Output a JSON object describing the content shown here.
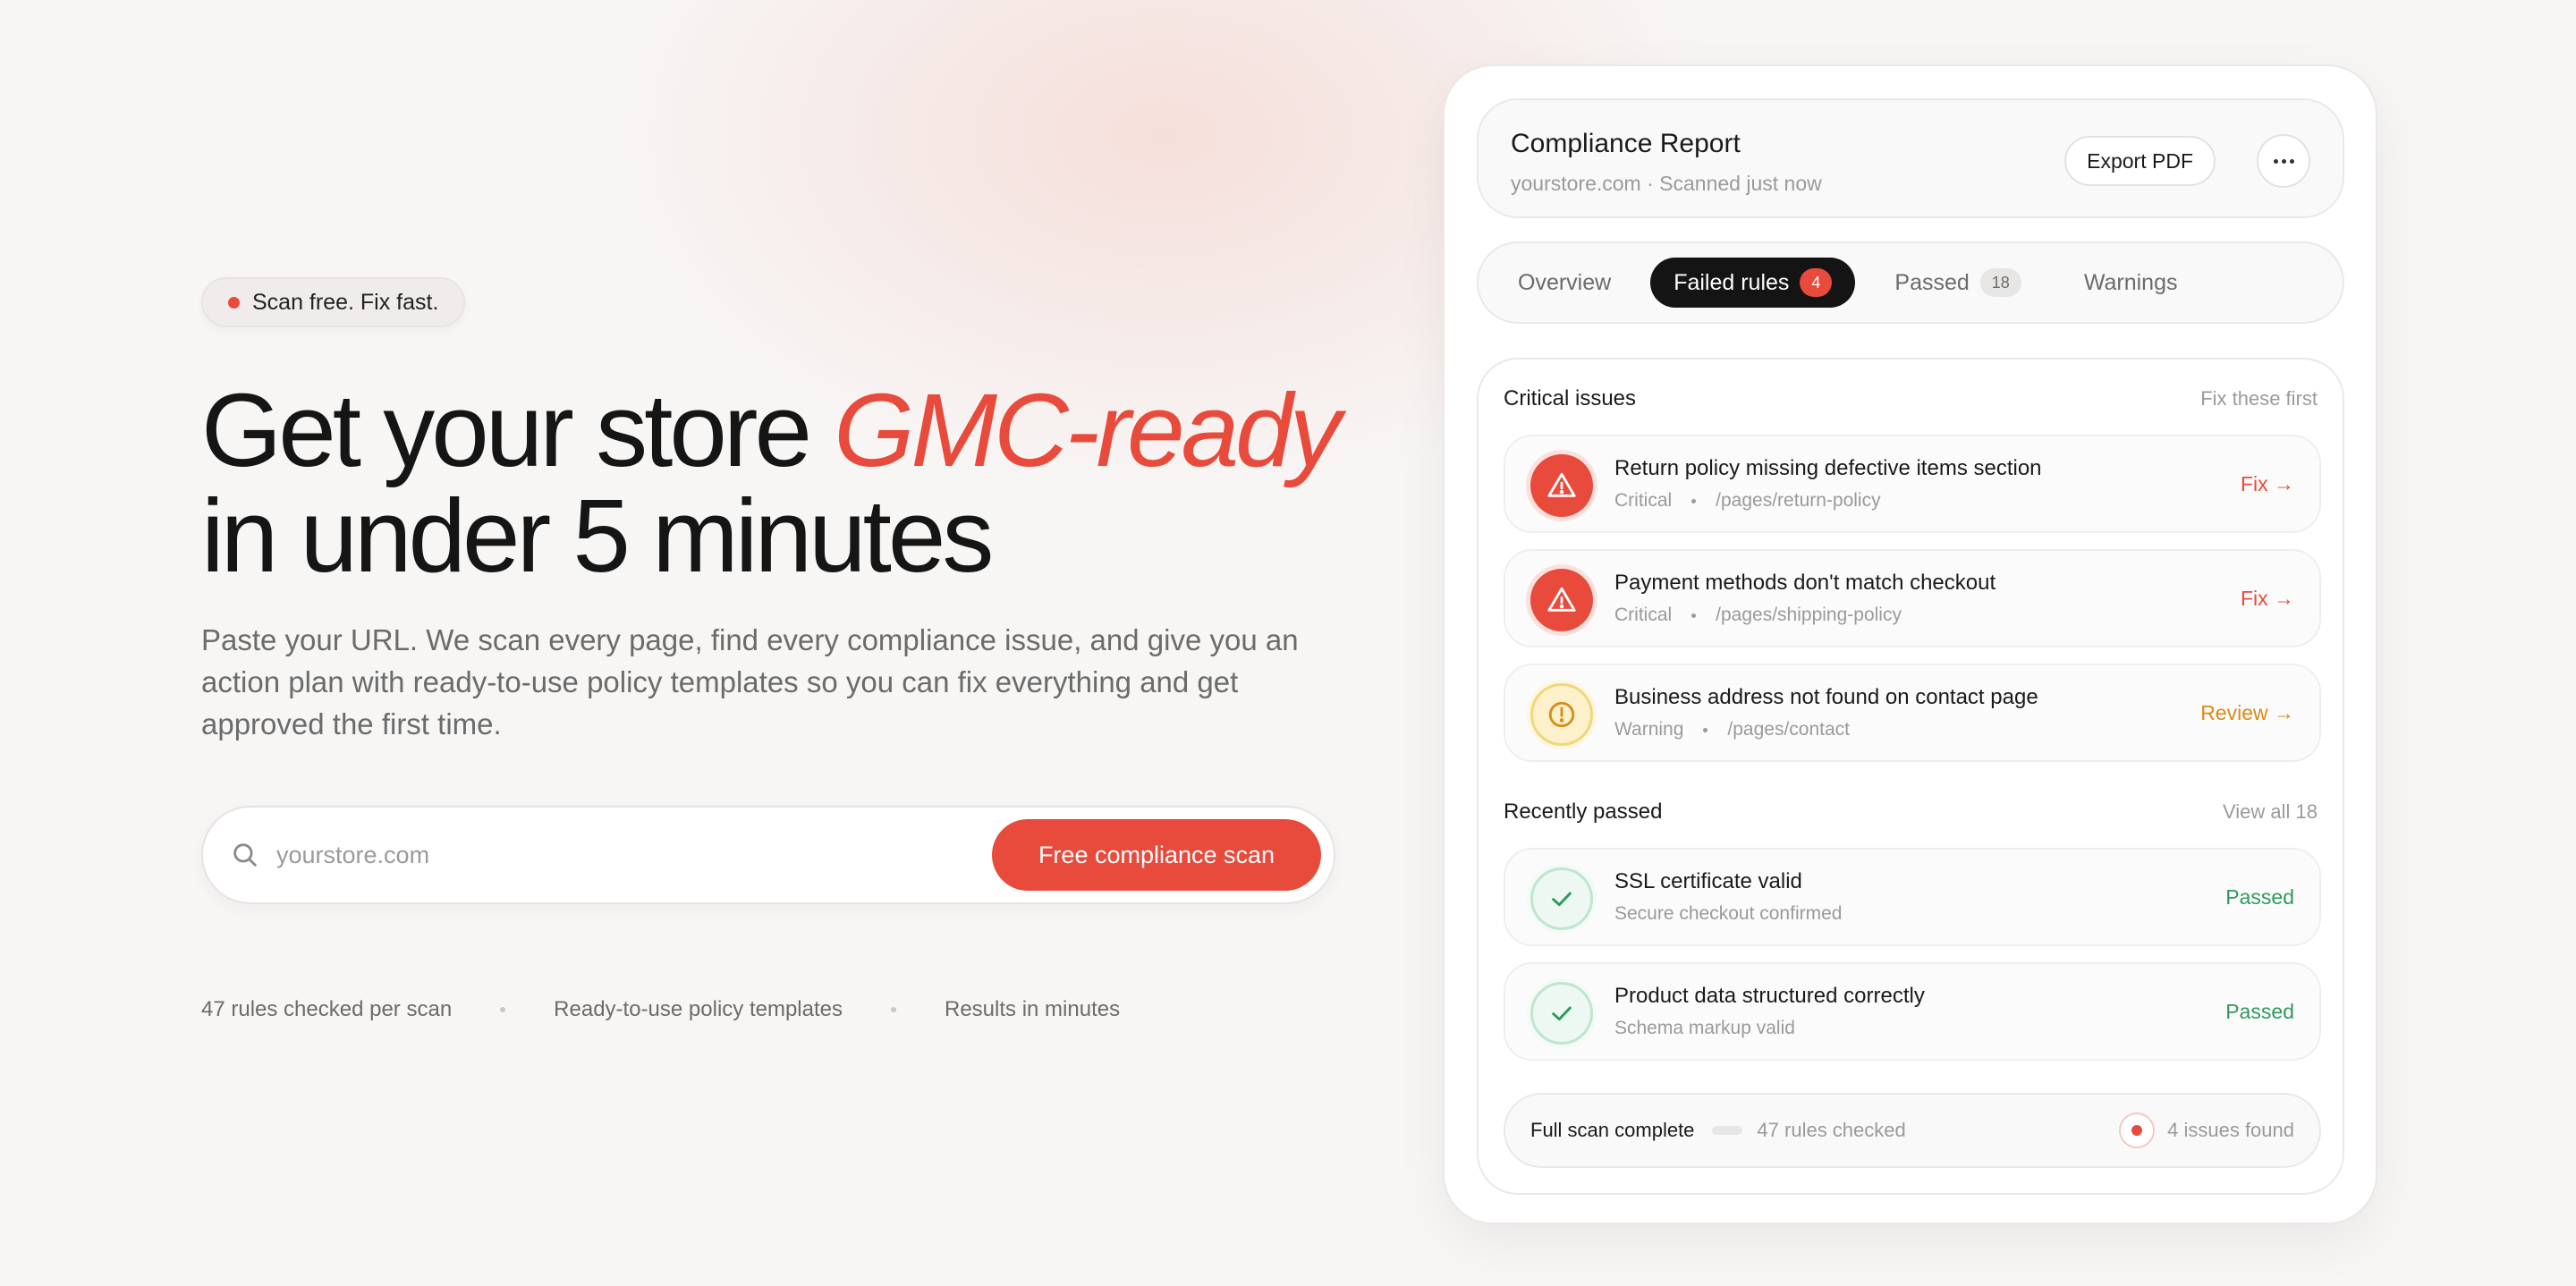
{
  "hero": {
    "tag": "Scan free. Fix fast.",
    "headline_pre": "Get your store ",
    "headline_accent": "GMC-ready",
    "headline_post": "in under 5 minutes",
    "subtext": "Paste your URL. We scan every page, find every compliance issue, and give you an action plan with ready-to-use policy templates so you can fix everything and get approved the first time.",
    "search_placeholder": "yourstore.com",
    "cta_label": "Free compliance scan",
    "stats": [
      "47 rules checked per scan",
      "Ready-to-use policy templates",
      "Results in minutes"
    ]
  },
  "report": {
    "title": "Compliance Report",
    "meta": "yourstore.com · Scanned just now",
    "export_label": "Export PDF",
    "tabs": [
      {
        "label": "Overview"
      },
      {
        "label": "Failed rules",
        "count": "4"
      },
      {
        "label": "Passed",
        "count": "18"
      },
      {
        "label": "Warnings"
      }
    ],
    "critical": {
      "label": "Critical issues",
      "action": "Fix these first",
      "items": [
        {
          "title": "Return policy missing defective items section",
          "severity": "Critical",
          "path": "/pages/return-policy",
          "action": "Fix →"
        },
        {
          "title": "Payment methods don't match checkout",
          "severity": "Critical",
          "path": "/pages/shipping-policy",
          "action": "Fix →"
        },
        {
          "title": "Business address not found on contact page",
          "severity": "Warning",
          "path": "/pages/contact",
          "action": "Review →"
        }
      ]
    },
    "passed": {
      "label": "Recently passed",
      "action": "View all 18",
      "items": [
        {
          "title": "SSL certificate valid",
          "detail": "Secure checkout confirmed",
          "status": "Passed"
        },
        {
          "title": "Product data structured correctly",
          "detail": "Schema markup valid",
          "status": "Passed"
        }
      ]
    },
    "footer": {
      "done": "Full scan complete",
      "rules": "47 rules checked",
      "issues": "4 issues found"
    }
  },
  "colors": {
    "accent": "#e84a3b",
    "warning": "#d98a17",
    "success": "#2e9a5c"
  },
  "icons": [
    "search-icon",
    "more-icon",
    "alert-triangle-icon",
    "alert-circle-icon",
    "check-icon"
  ]
}
